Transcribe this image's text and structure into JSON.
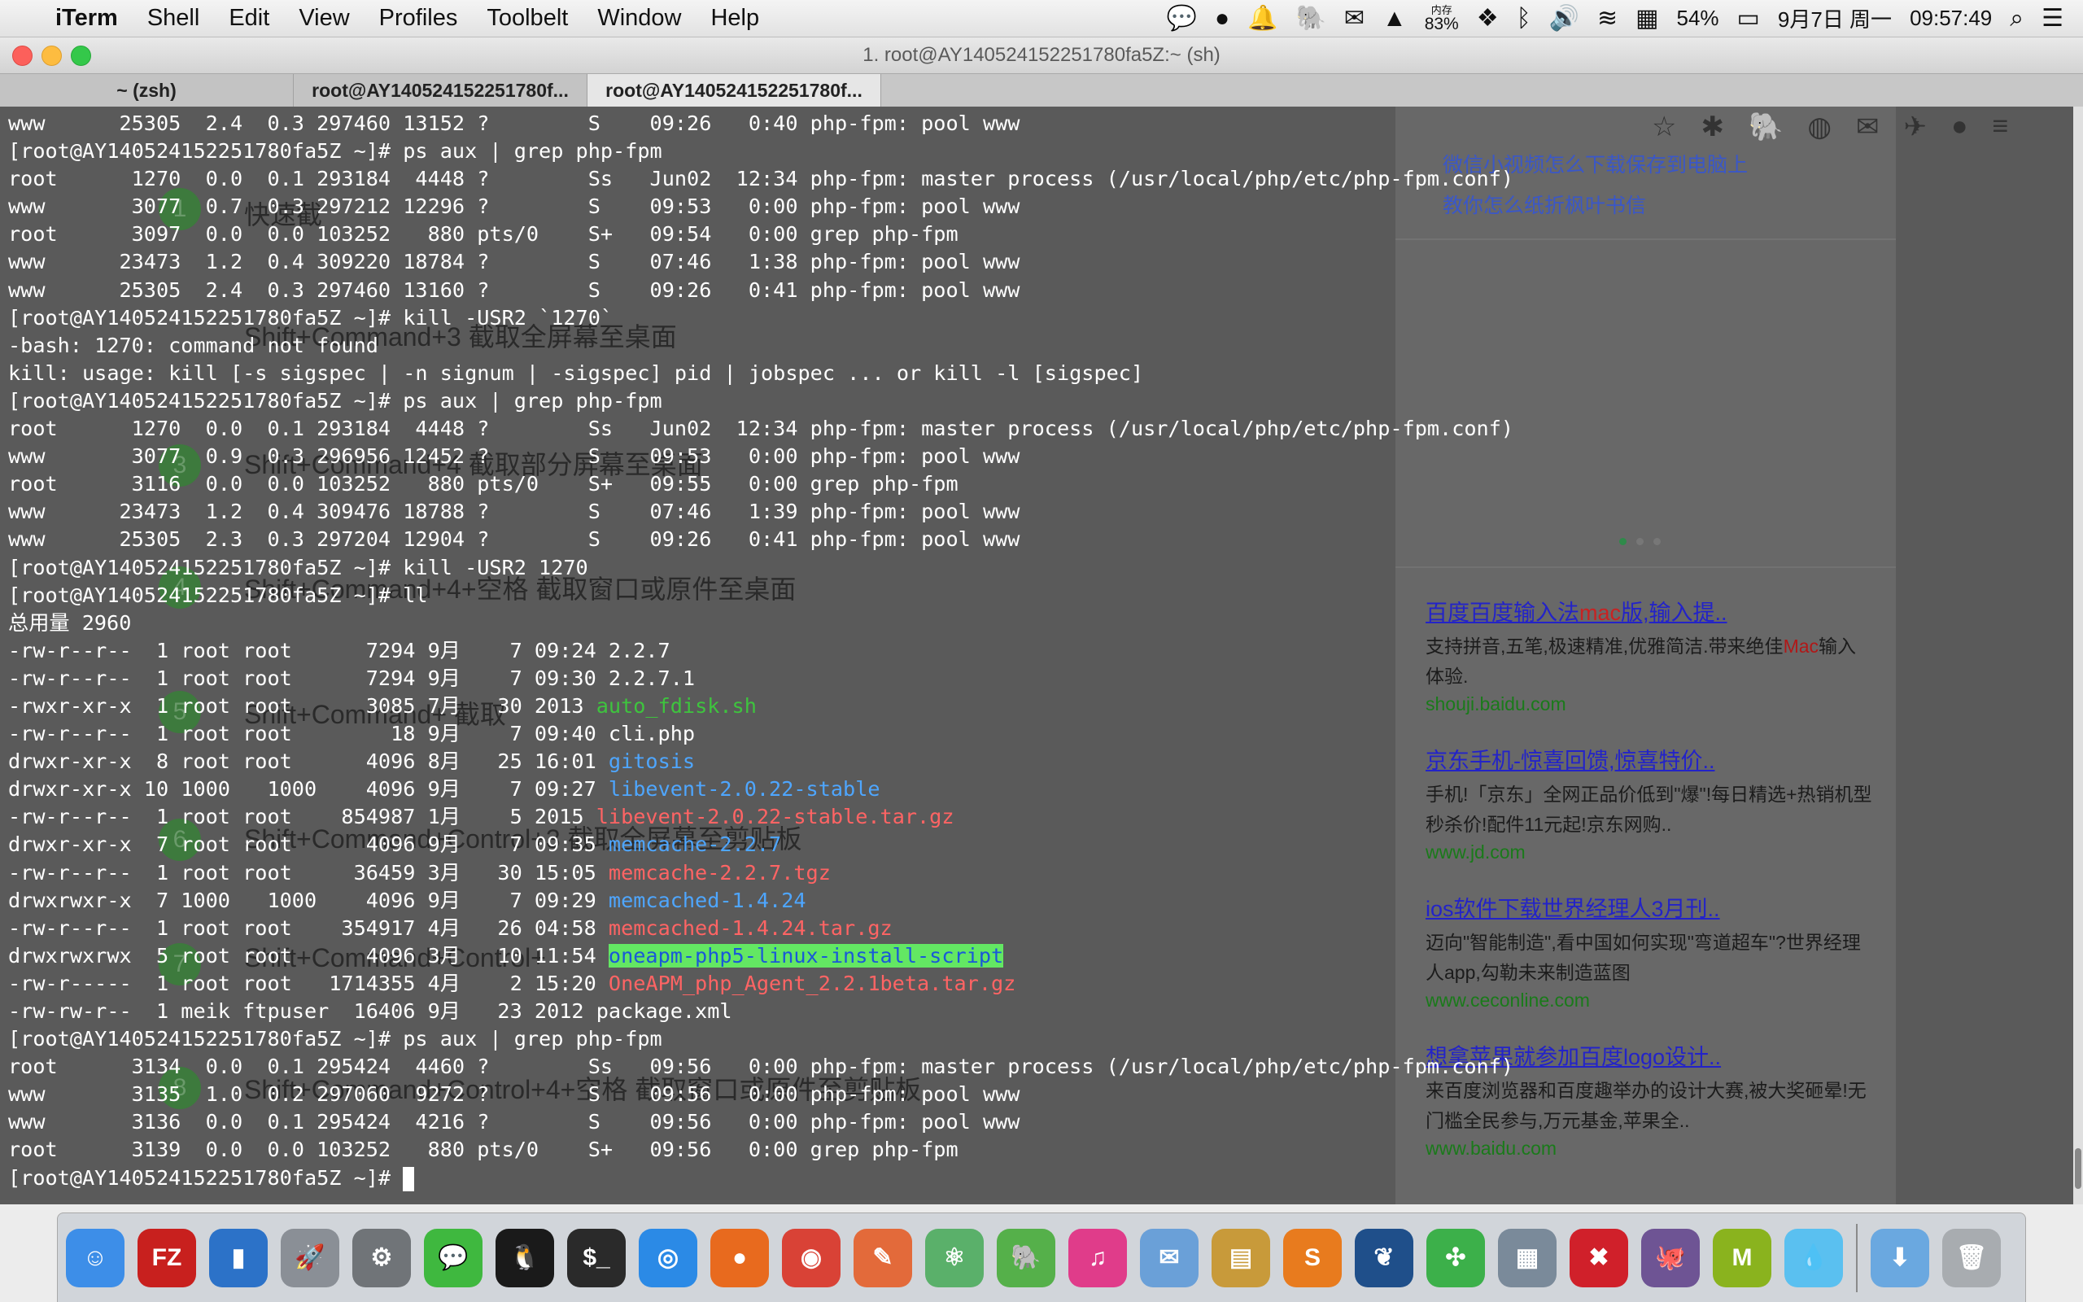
{
  "menubar": {
    "apple": "",
    "app_name": "iTerm",
    "items": [
      "Shell",
      "Edit",
      "View",
      "Profiles",
      "Toolbelt",
      "Window",
      "Help"
    ],
    "status": {
      "memory_label": "内存",
      "memory_value": "83%",
      "battery": "54%",
      "date": "9月7日 周一",
      "time": "09:57:49"
    }
  },
  "window": {
    "title": "1. root@AY140524152251780fa5Z:~ (sh)"
  },
  "tabs": [
    {
      "label": "~ (zsh)"
    },
    {
      "label": "root@AY140524152251780f..."
    },
    {
      "label": "root@AY140524152251780f..."
    }
  ],
  "terminal": {
    "lines": [
      {
        "text": "www      25305  2.4  0.3 297460 13152 ?        S    09:26   0:40 php-fpm: pool www"
      },
      {
        "text": "[root@AY140524152251780fa5Z ~]# ps aux | grep php-fpm"
      },
      {
        "text": "root      1270  0.0  0.1 293184  4448 ?        Ss   Jun02  12:34 php-fpm: master process (/usr/local/php/etc/php-fpm.conf)"
      },
      {
        "text": "www       3077  0.7  0.3 297212 12296 ?        S    09:53   0:00 php-fpm: pool www"
      },
      {
        "text": "root      3097  0.0  0.0 103252   880 pts/0    S+   09:54   0:00 grep php-fpm"
      },
      {
        "text": "www      23473  1.2  0.4 309220 18784 ?        S    07:46   1:38 php-fpm: pool www"
      },
      {
        "text": "www      25305  2.4  0.3 297460 13160 ?        S    09:26   0:41 php-fpm: pool www"
      },
      {
        "text": "[root@AY140524152251780fa5Z ~]# kill -USR2 `1270`"
      },
      {
        "text": "-bash: 1270: command not found"
      },
      {
        "text": "kill: usage: kill [-s sigspec | -n signum | -sigspec] pid | jobspec ... or kill -l [sigspec]"
      },
      {
        "text": "[root@AY140524152251780fa5Z ~]# ps aux | grep php-fpm"
      },
      {
        "text": "root      1270  0.0  0.1 293184  4448 ?        Ss   Jun02  12:34 php-fpm: master process (/usr/local/php/etc/php-fpm.conf)"
      },
      {
        "text": "www       3077  0.9  0.3 296956 12452 ?        S    09:53   0:00 php-fpm: pool www"
      },
      {
        "text": "root      3116  0.0  0.0 103252   880 pts/0    S+   09:55   0:00 grep php-fpm"
      },
      {
        "text": "www      23473  1.2  0.4 309476 18788 ?        S    07:46   1:39 php-fpm: pool www"
      },
      {
        "text": "www      25305  2.3  0.3 297204 12904 ?        S    09:26   0:41 php-fpm: pool www"
      },
      {
        "text": "[root@AY140524152251780fa5Z ~]# kill -USR2 1270"
      },
      {
        "text": "[root@AY140524152251780fa5Z ~]# ll"
      },
      {
        "text": "总用量 2960"
      },
      {
        "text": "-rw-r--r--  1 root root      7294 9月    7 09:24 2.2.7"
      },
      {
        "text": "-rw-r--r--  1 root root      7294 9月    7 09:30 2.2.7.1"
      },
      {
        "text": "-rwxr-xr-x  1 root root      3085 7月   30 2013 ",
        "name": "auto_fdisk.sh",
        "color": "green"
      },
      {
        "text": "-rw-r--r--  1 root root        18 9月    7 09:40 cli.php"
      },
      {
        "text": "drwxr-xr-x  8 root root      4096 8月   25 16:01 ",
        "name": "gitosis",
        "color": "blue"
      },
      {
        "text": "drwxr-xr-x 10 1000   1000    4096 9月    7 09:27 ",
        "name": "libevent-2.0.22-stable",
        "color": "blue"
      },
      {
        "text": "-rw-r--r--  1 root root    854987 1月    5 2015 ",
        "name": "libevent-2.0.22-stable.tar.gz",
        "color": "red"
      },
      {
        "text": "drwxr-xr-x  7 root root      4096 9月    7 09:35 ",
        "name": "memcache-2.2.7",
        "color": "blue"
      },
      {
        "text": "-rw-r--r--  1 root root     36459 3月   30 15:05 ",
        "name": "memcache-2.2.7.tgz",
        "color": "red"
      },
      {
        "text": "drwxrwxr-x  7 1000   1000    4096 9月    7 09:29 ",
        "name": "memcached-1.4.24",
        "color": "blue"
      },
      {
        "text": "-rw-r--r--  1 root root    354917 4月   26 04:58 ",
        "name": "memcached-1.4.24.tar.gz",
        "color": "red"
      },
      {
        "text": "drwxrwxrwx  5 root root      4096 3月   10 11:54 ",
        "name": "oneapm-php5-linux-install-script",
        "color": "hl"
      },
      {
        "text": "-rw-r-----  1 root root   1714355 4月    2 15:20 ",
        "name": "OneAPM_php_Agent_2.2.1beta.tar.gz",
        "color": "red"
      },
      {
        "text": "-rw-rw-r--  1 meik ftpuser  16406 9月   23 2012 package.xml"
      },
      {
        "text": "[root@AY140524152251780fa5Z ~]# ps aux | grep php-fpm"
      },
      {
        "text": "root      3134  0.0  0.1 295424  4460 ?        Ss   09:56   0:00 php-fpm: master process (/usr/local/php/etc/php-fpm.conf)"
      },
      {
        "text": "www       3135  1.0  0.2 297060  9272 ?        S    09:56   0:00 php-fpm: pool www"
      },
      {
        "text": "www       3136  0.0  0.1 295424  4216 ?        S    09:56   0:00 php-fpm: pool www"
      },
      {
        "text": "root      3139  0.0  0.0 103252   880 pts/0    S+   09:56   0:00 grep php-fpm"
      },
      {
        "text": "[root@AY140524152251780fa5Z ~]# ",
        "cursor": true
      }
    ]
  },
  "background_page": {
    "top_links": [
      "微信小视频怎么下载保存到电脑上",
      "教你怎么纸折枫叶书信"
    ],
    "shortcuts": [
      {
        "num": "1",
        "text": "快速截"
      },
      {
        "num": "2",
        "text": "Shift+Command+3 截取全屏幕至桌面"
      },
      {
        "num": "3",
        "text": "Shift+Command+4 截取部分屏幕至桌面"
      },
      {
        "num": "4",
        "text": "Shift+Command+4+空格 截取窗口或原件至桌面"
      },
      {
        "num": "5",
        "text": "Shift+Command+ 截取"
      },
      {
        "num": "6",
        "text": "Shift+Command+Control+3 截取全屏幕至剪贴板"
      },
      {
        "num": "7",
        "text": "Shift+Command+Control+"
      },
      {
        "num": "8",
        "text": "Shift+Command+Control+4+空格 截取窗口或原件至剪贴板"
      }
    ],
    "ads": [
      {
        "title_a": "百度百度输入法",
        "title_red": "mac",
        "title_b": "版,输入提..",
        "desc_a": "支持拼音,五笔,极速精准,优雅简洁.带来绝佳",
        "desc_red": "Mac",
        "desc_b": "输入体验.",
        "url": "shouji.baidu.com"
      },
      {
        "title_a": "京东手机-惊喜回馈,惊喜特价..",
        "title_red": "",
        "title_b": "",
        "desc_a": "手机!「京东」全网正品价低到\"爆\"!每日精选+热销机型秒杀价!配件11元起!京东网购..",
        "desc_red": "",
        "desc_b": "",
        "url": "www.jd.com"
      },
      {
        "title_a": "ios软件下载世界经理人3月刊..",
        "title_red": "",
        "title_b": "",
        "desc_a": "迈向\"智能制造\",看中国如何实现\"弯道超车\"?世界经理人app,勾勒未来制造蓝图",
        "desc_red": "",
        "desc_b": "",
        "url": "www.ceconline.com"
      },
      {
        "title_a": "想拿苹果就参加百度logo设计..",
        "title_red": "",
        "title_b": "",
        "desc_a": "来百度浏览器和百度趣举办的设计大赛,被大奖砸晕!无门槛全民参与,万元基金,苹果全..",
        "desc_red": "",
        "desc_b": "",
        "url": "www.baidu.com"
      }
    ]
  },
  "dock": {
    "apps": [
      {
        "name": "finder",
        "glyph": "☺",
        "color": "#3d8ee8"
      },
      {
        "name": "filezilla",
        "glyph": "FZ",
        "color": "#c8201e"
      },
      {
        "name": "activity-monitor",
        "glyph": "▮",
        "color": "#2c72c8"
      },
      {
        "name": "launchpad",
        "glyph": "🚀",
        "color": "#8a8f96"
      },
      {
        "name": "system-preferences",
        "glyph": "⚙",
        "color": "#707478"
      },
      {
        "name": "wechat",
        "glyph": "💬",
        "color": "#3fb83f"
      },
      {
        "name": "qq",
        "glyph": "🐧",
        "color": "#1a1a1a"
      },
      {
        "name": "terminal",
        "glyph": "$_",
        "color": "#2a2a2a"
      },
      {
        "name": "safari",
        "glyph": "◎",
        "color": "#2b8ae6"
      },
      {
        "name": "firefox",
        "glyph": "●",
        "color": "#e86a1e"
      },
      {
        "name": "chrome",
        "glyph": "◉",
        "color": "#d94236"
      },
      {
        "name": "pencil",
        "glyph": "✎",
        "color": "#e36a3a"
      },
      {
        "name": "atom",
        "glyph": "⚛",
        "color": "#5ab06a"
      },
      {
        "name": "evernote",
        "glyph": "🐘",
        "color": "#55b04a"
      },
      {
        "name": "itunes",
        "glyph": "♫",
        "color": "#e03c8a"
      },
      {
        "name": "contacts",
        "glyph": "✉",
        "color": "#6aa0d8"
      },
      {
        "name": "sequel-pro",
        "glyph": "▤",
        "color": "#c89a3a"
      },
      {
        "name": "sublime-text",
        "glyph": "S",
        "color": "#e87b1e"
      },
      {
        "name": "sourcetree",
        "glyph": "❦",
        "color": "#1f4f8a"
      },
      {
        "name": "xmind",
        "glyph": "✣",
        "color": "#3cb04a"
      },
      {
        "name": "preview",
        "glyph": "▦",
        "color": "#7a8a9a"
      },
      {
        "name": "xmind-zen",
        "glyph": "✖",
        "color": "#d0202a"
      },
      {
        "name": "github",
        "glyph": "🐙",
        "color": "#6e5494"
      },
      {
        "name": "mindnode",
        "glyph": "M",
        "color": "#8ab31e"
      },
      {
        "name": "tweetbot",
        "glyph": "💧",
        "color": "#5ac0f0"
      }
    ],
    "right": [
      {
        "name": "downloads",
        "glyph": "⬇",
        "color": "#6aa8e0"
      },
      {
        "name": "trash",
        "glyph": "🗑",
        "color": "#a8acb0"
      }
    ]
  }
}
